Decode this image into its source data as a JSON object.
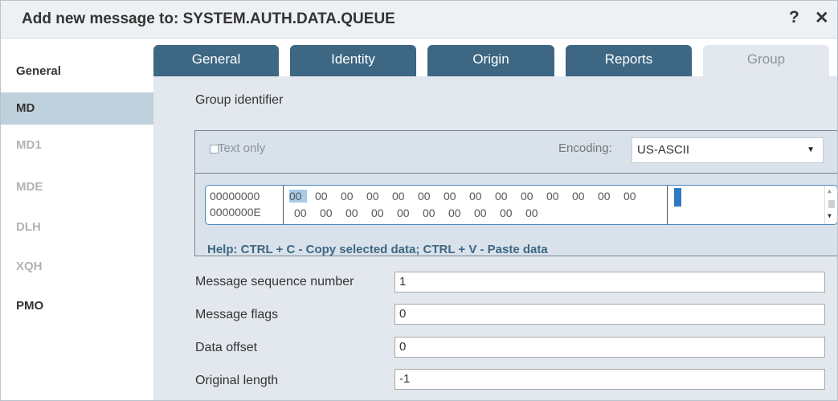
{
  "dialog": {
    "title": "Add new message to: SYSTEM.AUTH.DATA.QUEUE",
    "help_icon": "?",
    "close_icon": "✕"
  },
  "sidebar": {
    "items": [
      {
        "label": "General",
        "state": "enabled"
      },
      {
        "label": "MD",
        "state": "active"
      },
      {
        "label": "MD1",
        "state": "disabled"
      },
      {
        "label": "MDE",
        "state": "disabled"
      },
      {
        "label": "DLH",
        "state": "disabled"
      },
      {
        "label": "XQH",
        "state": "disabled"
      },
      {
        "label": "PMO",
        "state": "enabled"
      }
    ]
  },
  "tabs": [
    {
      "label": "General"
    },
    {
      "label": "Identity"
    },
    {
      "label": "Origin"
    },
    {
      "label": "Reports"
    },
    {
      "label": "Group",
      "active": true
    }
  ],
  "group": {
    "section_label": "Group identifier",
    "text_only_label": "Text only",
    "text_only_checked": false,
    "encoding_label": "Encoding:",
    "encoding_value": "US-ASCII",
    "offsets": [
      "00000000",
      "0000000E"
    ],
    "row1_bytes": [
      "00",
      "00",
      "00",
      "00",
      "00",
      "00",
      "00",
      "00",
      "00",
      "00",
      "00",
      "00",
      "00",
      "00"
    ],
    "row2_bytes": [
      "00",
      "00",
      "00",
      "00",
      "00",
      "00",
      "00",
      "00",
      "00",
      "00"
    ],
    "help_text": "Help: CTRL + C - Copy selected data; CTRL + V - Paste data"
  },
  "fields": {
    "seq_label": "Message sequence number",
    "seq_value": "1",
    "flags_label": "Message flags",
    "flags_value": "0",
    "offset_label": "Data offset",
    "offset_value": "0",
    "length_label": "Original length",
    "length_value": "-1"
  },
  "colors": {
    "tab_dark": "#3d6783",
    "active_sidebar": "#bfd1dc",
    "panel_bg": "#e3e8ee",
    "selection": "#a8cbe9"
  }
}
